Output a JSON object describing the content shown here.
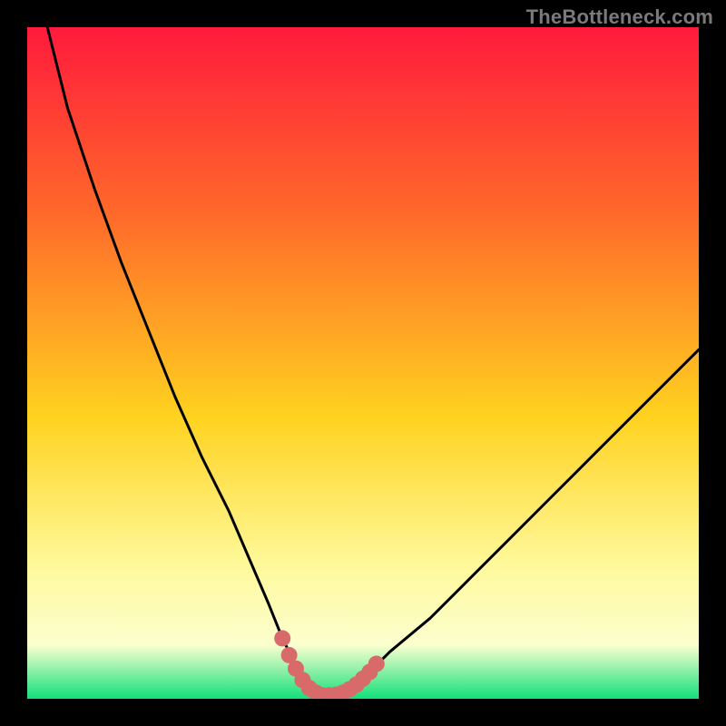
{
  "watermark": "TheBottleneck.com",
  "colors": {
    "frame": "#000000",
    "gradient_top": "#ff1a3c",
    "gradient_upper_mid": "#ff6a2a",
    "gradient_mid": "#ffd21f",
    "gradient_lower_mid": "#fff99a",
    "gradient_low": "#fbffcf",
    "gradient_bottom": "#12e07a",
    "curve": "#000000",
    "markers": "#d86a6a"
  },
  "chart_data": {
    "type": "line",
    "title": "",
    "xlabel": "",
    "ylabel": "",
    "xlim": [
      0,
      100
    ],
    "ylim": [
      0,
      100
    ],
    "series": [
      {
        "name": "bottleneck-curve",
        "x": [
          3,
          6,
          10,
          14,
          18,
          22,
          26,
          30,
          33,
          36,
          38,
          40,
          42,
          44,
          46,
          48,
          50,
          54,
          60,
          66,
          72,
          78,
          84,
          90,
          96,
          100
        ],
        "y": [
          100,
          88,
          76,
          65,
          55,
          45,
          36,
          28,
          21,
          14,
          9,
          5,
          2,
          0.5,
          0.5,
          1,
          3,
          7,
          12,
          18,
          24,
          30,
          36,
          42,
          48,
          52
        ]
      }
    ],
    "markers": {
      "name": "trough-markers",
      "points": [
        {
          "x": 38,
          "y": 9
        },
        {
          "x": 39,
          "y": 6.5
        },
        {
          "x": 40,
          "y": 4.5
        },
        {
          "x": 41,
          "y": 2.8
        },
        {
          "x": 42,
          "y": 1.6
        },
        {
          "x": 43,
          "y": 0.9
        },
        {
          "x": 44,
          "y": 0.5
        },
        {
          "x": 45,
          "y": 0.5
        },
        {
          "x": 46,
          "y": 0.6
        },
        {
          "x": 47,
          "y": 0.9
        },
        {
          "x": 48,
          "y": 1.4
        },
        {
          "x": 49,
          "y": 2.1
        },
        {
          "x": 50,
          "y": 3.0
        },
        {
          "x": 51,
          "y": 4.0
        },
        {
          "x": 52,
          "y": 5.2
        }
      ]
    }
  }
}
